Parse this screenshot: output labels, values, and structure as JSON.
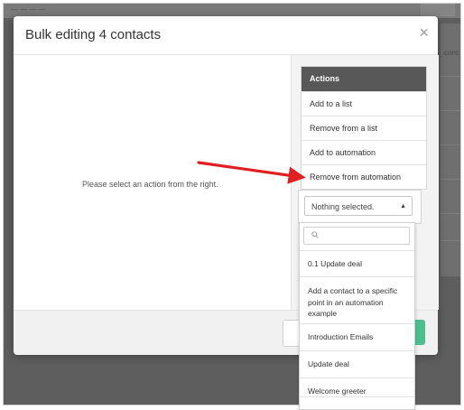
{
  "modal": {
    "title": "Bulk editing 4 contacts",
    "close_glyph": "×",
    "empty_message": "Please select an action from the right."
  },
  "actions": {
    "header": "Actions",
    "items": [
      {
        "label": "Add to a list"
      },
      {
        "label": "Remove from a list"
      },
      {
        "label": "Add to automation"
      },
      {
        "label": "Remove from automation"
      }
    ]
  },
  "automation_select": {
    "selected": "Nothing selected.",
    "caret": "▲",
    "search_placeholder": "",
    "options": [
      "0.1 Update deal",
      "Add a contact to a specific point in an automation example",
      "Introduction Emails",
      "Update deal",
      "Welcome greeter"
    ]
  },
  "background": {
    "top_left_text": "— — — —",
    "right_text": "conc"
  },
  "colors": {
    "overlay": "#5e5e5e",
    "actions_header": "#585858",
    "go_button": "#4cbf8f",
    "annotation_arrow": "#e02020"
  },
  "icons": [
    "close-icon",
    "search-icon",
    "caret-up-icon",
    "annotation-arrow"
  ]
}
